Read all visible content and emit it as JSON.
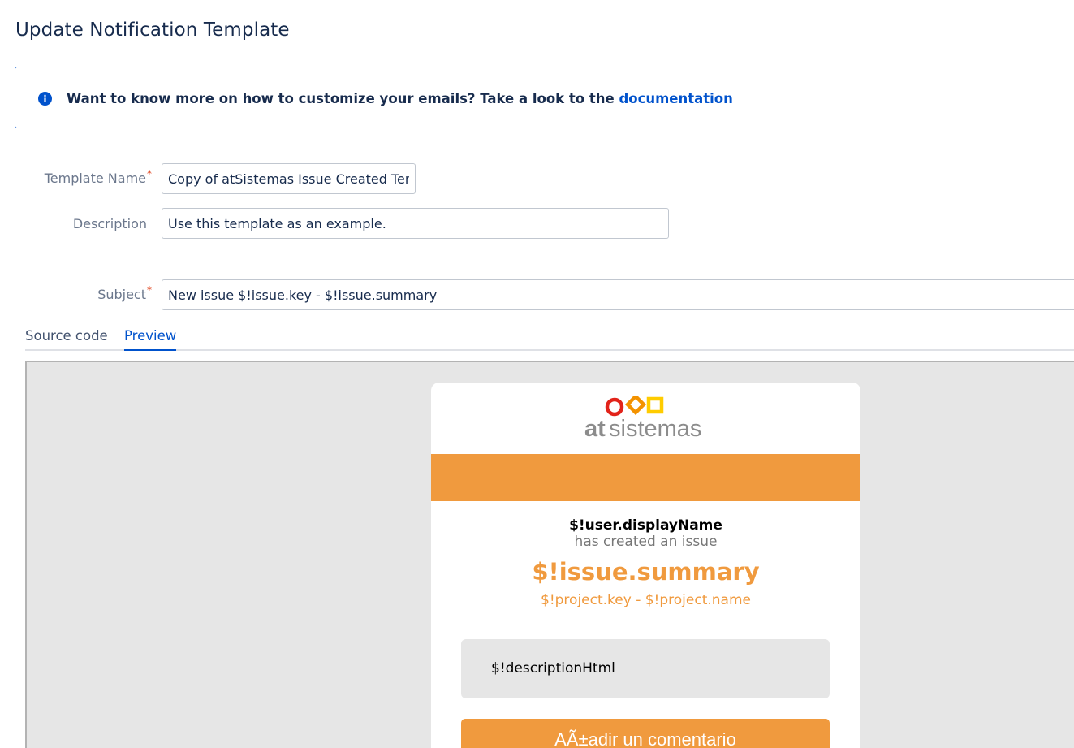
{
  "page": {
    "title": "Update Notification Template"
  },
  "info": {
    "text": "Want to know more on how to customize your emails? Take a look to the ",
    "link_label": "documentation",
    "icon": "info-icon"
  },
  "form": {
    "template_name": {
      "label": "Template Name",
      "required_mark": "*",
      "value": "Copy of atSistemas Issue Created Template"
    },
    "description": {
      "label": "Description",
      "value": "Use this template as an example."
    },
    "subject": {
      "label": "Subject",
      "required_mark": "*",
      "value": "New issue $!issue.key - $!issue.summary"
    }
  },
  "tabs": [
    {
      "label": "Source code",
      "selected": false
    },
    {
      "label": "Preview",
      "selected": true
    }
  ],
  "preview": {
    "logo": {
      "text_bold": "at",
      "text_light": "sistemas",
      "colors": [
        "#e2231a",
        "#f39200",
        "#ffcc00"
      ]
    },
    "user": "$!user.displayName",
    "action": "has created an issue",
    "summary": "$!issue.summary",
    "project": "$!project.key - $!project.name",
    "description": "$!descriptionHtml",
    "comment_button": "AÃ±adir un comentario"
  },
  "colors": {
    "accent": "#0052cc",
    "email_orange": "#f09a3e",
    "required": "#de350b"
  }
}
